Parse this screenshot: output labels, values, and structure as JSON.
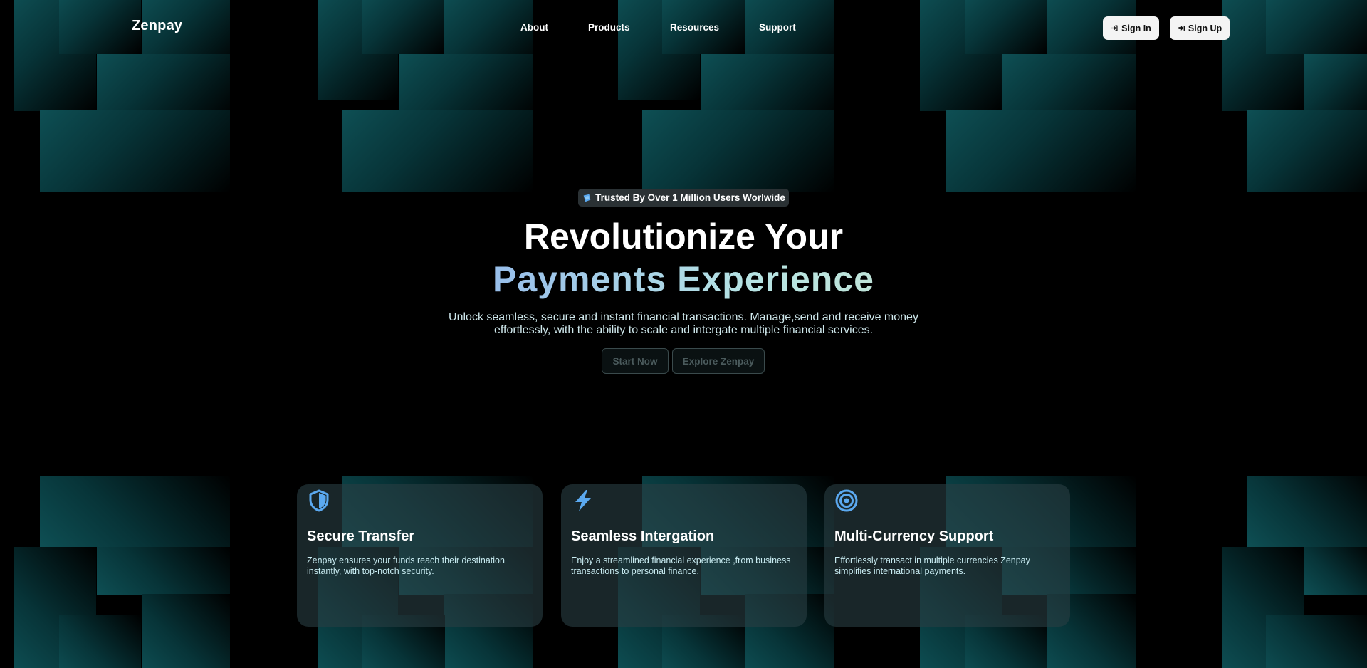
{
  "brand": {
    "name": "Zenpay"
  },
  "nav": {
    "links": [
      {
        "label": "About"
      },
      {
        "label": "Products"
      },
      {
        "label": "Resources"
      },
      {
        "label": "Support"
      }
    ],
    "sign_in": "Sign In",
    "sign_up": "Sign Up"
  },
  "hero": {
    "badge": "Trusted By Over 1 Million Users Worlwide",
    "title_line1": "Revolutionize Your",
    "title_line2": "Payments Experience",
    "subtitle": "Unlock seamless, secure and instant financial transactions. Manage,send and receive money effortlessly, with the ability to scale and intergate multiple financial services.",
    "cta_primary": "Start Now",
    "cta_secondary": "Explore Zenpay"
  },
  "features": [
    {
      "icon": "shield-icon",
      "title": "Secure Transfer",
      "description": "Zenpay ensures your funds reach their destination instantly, with top-notch security."
    },
    {
      "icon": "lightning-icon",
      "title": "Seamless Intergation",
      "description": "Enjoy a streamlined financial experience ,from business transactions to personal finance."
    },
    {
      "icon": "target-icon",
      "title": "Multi-Currency Support",
      "description": "Effortlessly transact in multiple currencies Zenpay simplifies international payments."
    }
  ],
  "colors": {
    "background": "#000000",
    "tile_accent": "#0e4f54",
    "icon_accent": "#5ba9f0",
    "card_bg": "#283e42",
    "subtitle_text": "#cfe8ec"
  }
}
